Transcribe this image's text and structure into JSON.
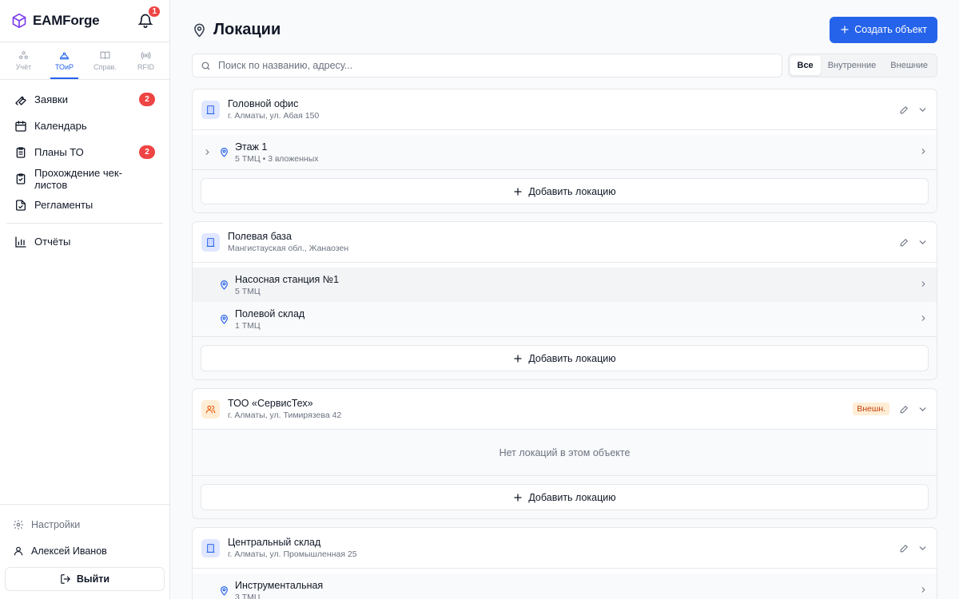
{
  "app": {
    "name": "EAMForge",
    "notifications": "1"
  },
  "modules": [
    {
      "label": "Учёт",
      "icon": "layers-icon",
      "active": false
    },
    {
      "label": "ТОиР",
      "icon": "hard-hat-icon",
      "active": true
    },
    {
      "label": "Справ.",
      "icon": "book-icon",
      "active": false
    },
    {
      "label": "RFID",
      "icon": "radio-icon",
      "active": false
    }
  ],
  "nav": {
    "requests": {
      "label": "Заявки",
      "badge": "2"
    },
    "calendar": {
      "label": "Календарь"
    },
    "plans": {
      "label": "Планы ТО",
      "badge": "2"
    },
    "checklists": {
      "label": "Прохождение чек-листов"
    },
    "regulations": {
      "label": "Регламенты"
    },
    "reports": {
      "label": "Отчёты"
    }
  },
  "footer": {
    "settings": "Настройки",
    "user": "Алексей Иванов",
    "logout": "Выйти"
  },
  "page": {
    "title": "Локации",
    "create_label": "Создать объект"
  },
  "search": {
    "placeholder": "Поиск по названию, адресу..."
  },
  "filters": {
    "all": "Все",
    "internal": "Внутренние",
    "external": "Внешние"
  },
  "add_location_label": "Добавить локацию",
  "empty_label": "Нет локаций в этом объекте",
  "objects": [
    {
      "name": "Головной офис",
      "address": "г. Алматы, ул. Абая 150",
      "locations": [
        {
          "name": "Этаж 1",
          "sub": "5 ТМЦ • 3 вложенных"
        }
      ]
    },
    {
      "name": "Полевая база",
      "address": "Мангистауская обл., Жанаозен",
      "locations": [
        {
          "name": "Насосная станция №1",
          "sub": "5 ТМЦ"
        },
        {
          "name": "Полевой склад",
          "sub": "1 ТМЦ"
        }
      ]
    },
    {
      "name": "ТОО «СервисТех»",
      "address": "г. Алматы, ул. Тимирязева 42",
      "badge": "Внешн.",
      "locations": []
    },
    {
      "name": "Центральный склад",
      "address": "г. Алматы, ул. Промышленная 25",
      "locations": [
        {
          "name": "Инструментальная",
          "sub": "3 ТМЦ"
        }
      ]
    }
  ],
  "colors": {
    "accent": "#2563eb",
    "badge": "#ef4444",
    "external": "#c2410c"
  }
}
